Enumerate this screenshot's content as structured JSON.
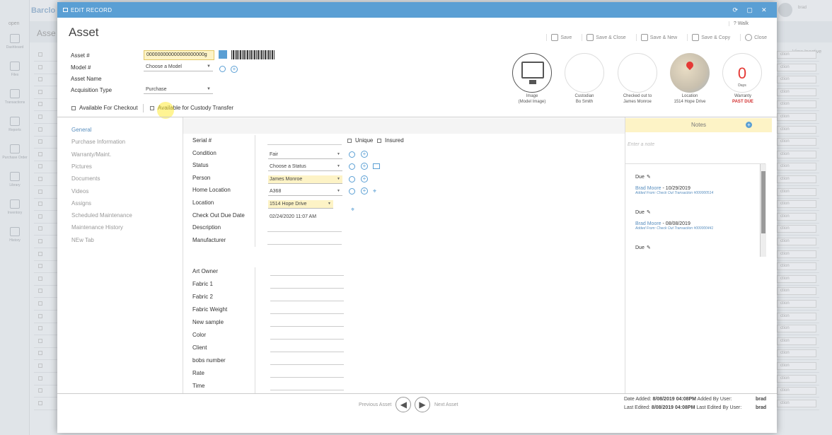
{
  "app": {
    "brand_fragment": "Barclo",
    "page_fragment": "Asse",
    "user_name": "brad",
    "open_label": "open",
    "view_inactive": "View Inactive",
    "col_hdr": "tion",
    "row_ddl": "ction"
  },
  "sidebar": [
    {
      "label": "Dashboard",
      "icon": "dashboard-icon"
    },
    {
      "label": "Files",
      "icon": "files-icon"
    },
    {
      "label": "Transactions",
      "icon": "transactions-icon"
    },
    {
      "label": "Reports",
      "icon": "reports-icon"
    },
    {
      "label": "Purchase Order",
      "icon": "purchase-order-icon"
    },
    {
      "label": "Library",
      "icon": "library-icon"
    },
    {
      "label": "Inventory",
      "icon": "inventory-icon"
    },
    {
      "label": "History",
      "icon": "history-icon"
    }
  ],
  "modal": {
    "header": "EDIT RECORD",
    "title": "Asset",
    "walk": "Walk",
    "toolbar": {
      "save": "Save",
      "save_close": "Save & Close",
      "save_new": "Save & New",
      "save_copy": "Save & Copy",
      "close": "Close"
    }
  },
  "top_form": {
    "asset_label": "Asset #",
    "asset_value": "000000000000000000000g",
    "model_label": "Model #",
    "model_placeholder": "Choose a Model",
    "asset_name_label": "Asset Name",
    "acq_label": "Acquisition Type",
    "acq_value": "Purchase",
    "avail_checkout": "Available For Checkout",
    "avail_custody": "Available for Custody Transfer"
  },
  "cards": {
    "image": {
      "label": "Image",
      "sub": "(Model Image)"
    },
    "custodian": {
      "label": "Custodian",
      "sub": "Bo Smith"
    },
    "checked_out": {
      "label": "Checked out to",
      "sub": "James Monroe"
    },
    "location": {
      "label": "Location",
      "sub": "1514 Hope Drive"
    },
    "warranty": {
      "value": "0",
      "unit": "Days",
      "label": "Warranty",
      "status": "PAST DUE"
    }
  },
  "nav": [
    "General",
    "Purchase Information",
    "Warranty/Maint.",
    "Pictures",
    "Documents",
    "Videos",
    "Assigns",
    "Scheduled Maintenance",
    "Maintenance History",
    "NEw Tab"
  ],
  "fields": {
    "serial": "Serial #",
    "unique": "Unique",
    "insured": "Insured",
    "condition": "Condition",
    "condition_value": "Fair",
    "status": "Status",
    "status_value": "Choose a Status",
    "person": "Person",
    "person_value": "James Monroe",
    "home_location": "Home Location",
    "home_location_value": "A368",
    "location": "Location",
    "location_value": "1514 Hope Drive",
    "checkout_due": "Check Out Due Date",
    "checkout_due_value": "02/24/2020 11:07 AM",
    "description": "Description",
    "manufacturer": "Manufacturer"
  },
  "custom_fields": [
    "Art Owner",
    "Fabric 1",
    "Fabric 2",
    "Fabric Weight",
    "New sample",
    "Color",
    "Client",
    "bobs number",
    "Rate",
    "Time"
  ],
  "notes": {
    "header": "Notes",
    "placeholder": "Enter a note",
    "items": [
      {
        "due": "Due",
        "who": "Brad Moore",
        "date": " - 10/29/2019",
        "sub": "Added From: Check Out Transaction #000000514"
      },
      {
        "due": "Due",
        "who": "Brad Moore",
        "date": " - 08/08/2019",
        "sub": "Added From: Check Out Transaction #000000441"
      },
      {
        "due": "Due"
      }
    ]
  },
  "footer": {
    "prev": "Previous Asset",
    "next": "Next Asset",
    "date_added_label": "Date Added:",
    "date_added": "8/08/2019 04:08PM",
    "added_by_label": "Added By User:",
    "added_by": "brad",
    "last_edited_label": "Last Edited:",
    "last_edited": "8/08/2019 04:08PM",
    "edited_by_label": "Last Edited By User:",
    "edited_by": "brad"
  }
}
